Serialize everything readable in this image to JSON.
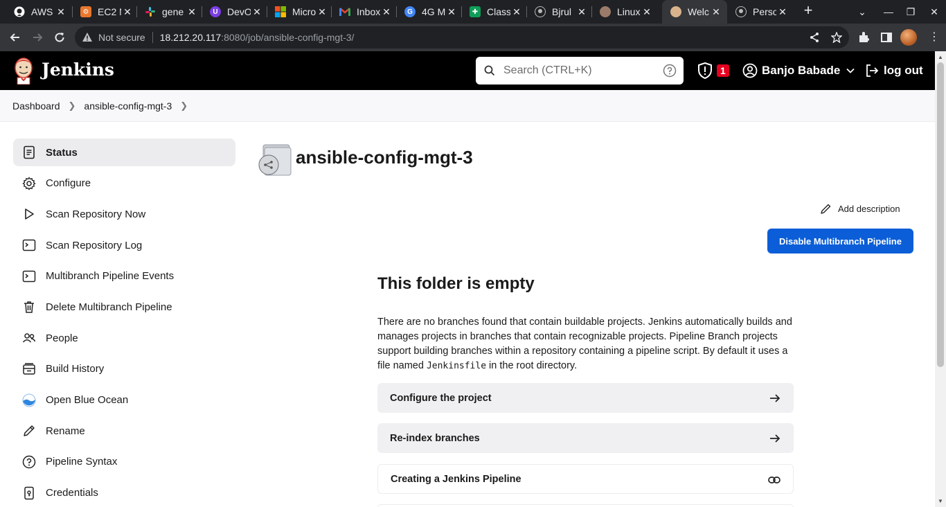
{
  "browser": {
    "tabs": [
      {
        "title": "AWS",
        "icon": "github-icon",
        "color": "#ffffff"
      },
      {
        "title": "EC2 M",
        "icon": "aws-icon",
        "color": "#e8772e"
      },
      {
        "title": "gene",
        "icon": "slack-icon",
        "color": "#e01e5a"
      },
      {
        "title": "DevO",
        "icon": "devops-icon",
        "color": "#7b3fe4"
      },
      {
        "title": "Micro",
        "icon": "microsoft-icon",
        "color": "#f25022"
      },
      {
        "title": "Inbox",
        "icon": "gmail-icon",
        "color": "#ea4335"
      },
      {
        "title": "4G M",
        "icon": "globe-icon",
        "color": "#4285f4"
      },
      {
        "title": "Class",
        "icon": "sheets-icon",
        "color": "#0f9d58"
      },
      {
        "title": "Bjrul",
        "icon": "github-icon",
        "color": "#ffffff"
      },
      {
        "title": "Linux",
        "icon": "avatar-icon",
        "color": "#9a7b6a"
      },
      {
        "title": "Welc",
        "icon": "jenkins-icon",
        "color": "#d9b38c"
      },
      {
        "title": "Perso",
        "icon": "github-icon",
        "color": "#ffffff"
      }
    ],
    "not_secure": "Not secure",
    "url_host": "18.212.20.117",
    "url_rest": ":8080/job/ansible-config-mgt-3/"
  },
  "header": {
    "brand": "Jenkins",
    "search_placeholder": "Search (CTRL+K)",
    "alert_count": "1",
    "user_name": "Banjo Babade",
    "logout": "log out"
  },
  "breadcrumb": {
    "items": [
      "Dashboard",
      "ansible-config-mgt-3"
    ]
  },
  "sidebar": {
    "items": [
      {
        "label": "Status",
        "icon": "status-icon"
      },
      {
        "label": "Configure",
        "icon": "gear-icon"
      },
      {
        "label": "Scan Repository Now",
        "icon": "play-icon"
      },
      {
        "label": "Scan Repository Log",
        "icon": "terminal-icon"
      },
      {
        "label": "Multibranch Pipeline Events",
        "icon": "terminal-icon"
      },
      {
        "label": "Delete Multibranch Pipeline",
        "icon": "trash-icon"
      },
      {
        "label": "People",
        "icon": "people-icon"
      },
      {
        "label": "Build History",
        "icon": "build-history-icon"
      },
      {
        "label": "Open Blue Ocean",
        "icon": "blue-ocean-icon"
      },
      {
        "label": "Rename",
        "icon": "pencil-icon"
      },
      {
        "label": "Pipeline Syntax",
        "icon": "help-icon"
      },
      {
        "label": "Credentials",
        "icon": "credentials-icon"
      }
    ]
  },
  "main": {
    "job_title": "ansible-config-mgt-3",
    "add_description": "Add description",
    "disable_button": "Disable Multibranch Pipeline",
    "empty_title": "This folder is empty",
    "empty_desc_before": "There are no branches found that contain buildable projects. Jenkins automatically builds and manages projects in branches that contain recognizable projects. Pipeline Branch projects support building branches within a repository containing a pipeline script. By default it uses a file named ",
    "empty_desc_code": "Jenkinsfile",
    "empty_desc_after": " in the root directory.",
    "cards": [
      {
        "label": "Configure the project",
        "icon": "arrow-right-icon"
      },
      {
        "label": "Re-index branches",
        "icon": "arrow-right-icon"
      },
      {
        "label": "Creating a Jenkins Pipeline",
        "icon": "link-icon"
      }
    ]
  },
  "colors": {
    "primary_button": "#0b5ed7",
    "alert_badge": "#e6001f",
    "header_bg": "#000000"
  }
}
